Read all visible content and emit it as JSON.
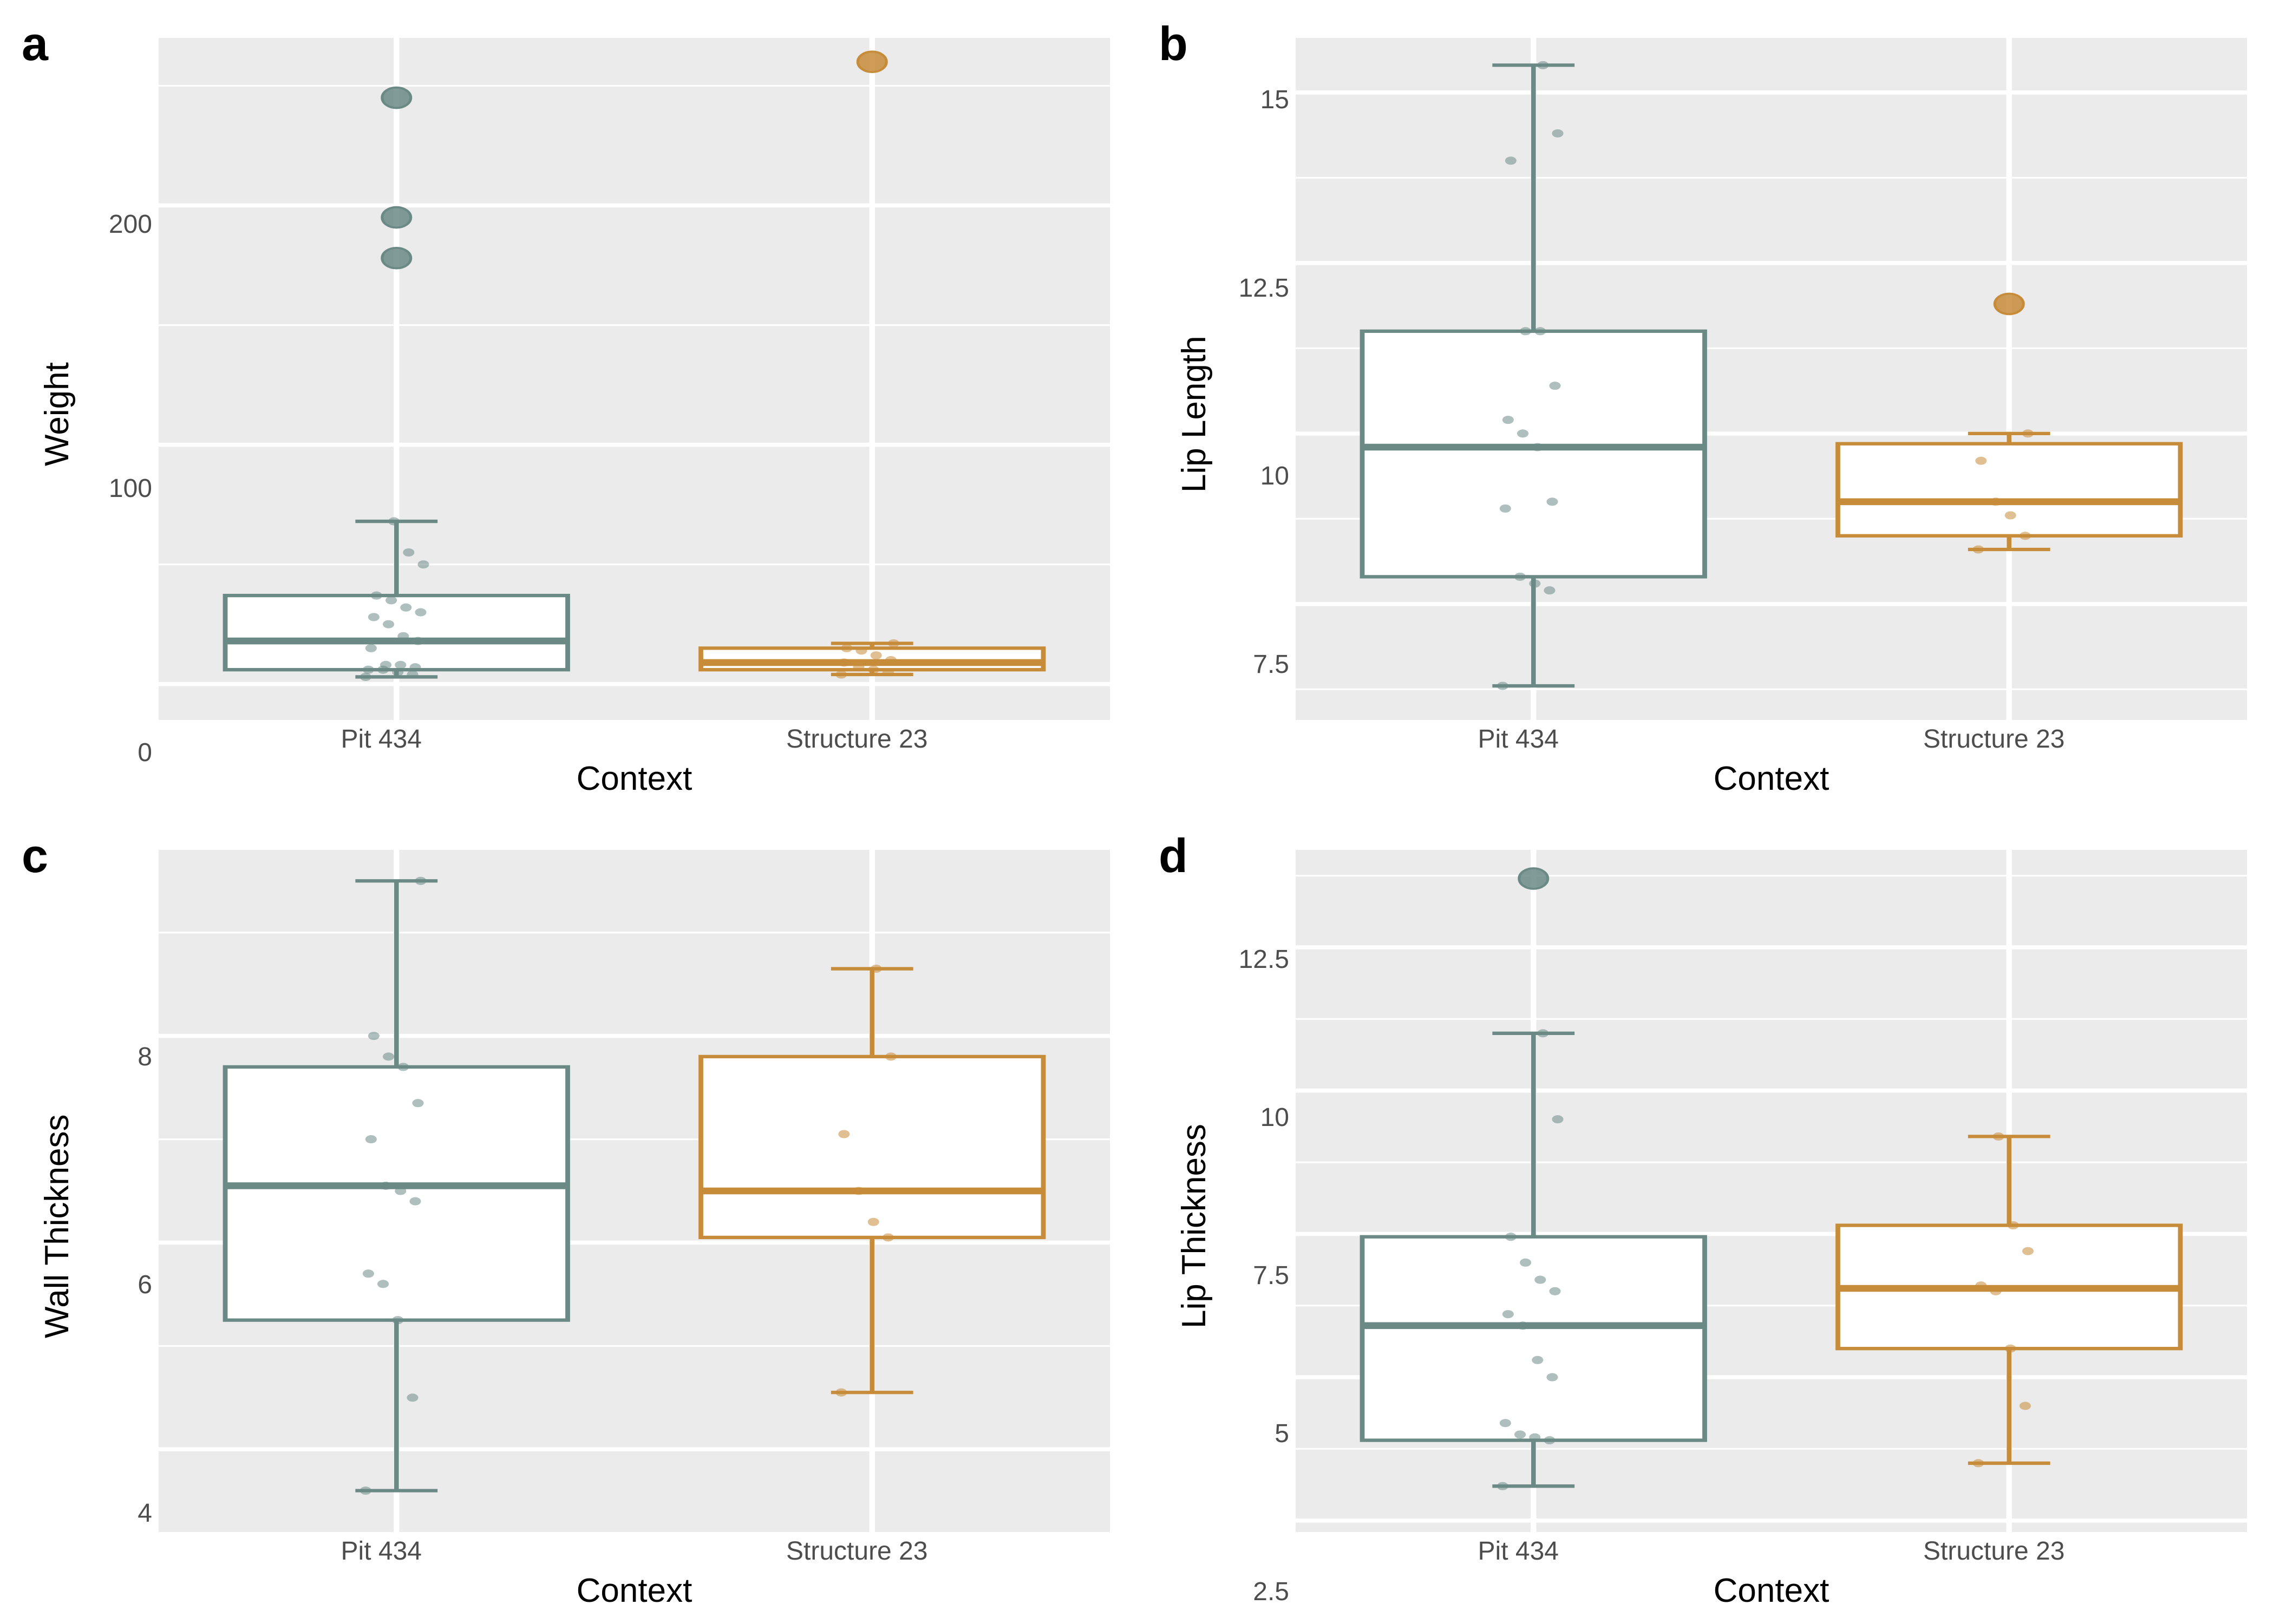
{
  "chart_data": [
    {
      "id": "a",
      "type": "box",
      "ylabel": "Weight",
      "xlabel": "Context",
      "categories": [
        "Pit 434",
        "Structure 23"
      ],
      "colors": [
        "#6b8a86",
        "#c78c3a"
      ],
      "ylim": [
        -15,
        270
      ],
      "yticks": [
        0,
        100,
        200
      ],
      "series": [
        {
          "context": "Pit 434",
          "q1": 6,
          "median": 18,
          "q3": 37,
          "whisker_lo": 3,
          "whisker_hi": 68,
          "outliers": [
            178,
            195,
            245
          ],
          "points": [
            3,
            4,
            5,
            6,
            6,
            7,
            8,
            8,
            15,
            18,
            20,
            25,
            28,
            30,
            32,
            35,
            37,
            50,
            55,
            68
          ]
        },
        {
          "context": "Structure 23",
          "q1": 6,
          "median": 9,
          "q3": 15,
          "whisker_lo": 4,
          "whisker_hi": 17,
          "outliers": [
            260
          ],
          "points": [
            4,
            5,
            6,
            7,
            9,
            10,
            12,
            14,
            15,
            17
          ]
        }
      ]
    },
    {
      "id": "b",
      "type": "box",
      "ylabel": "Lip Length",
      "xlabel": "Context",
      "categories": [
        "Pit 434",
        "Structure 23"
      ],
      "colors": [
        "#6b8a86",
        "#c78c3a"
      ],
      "ylim": [
        5.8,
        15.8
      ],
      "yticks": [
        7.5,
        10.0,
        12.5,
        15.0
      ],
      "series": [
        {
          "context": "Pit 434",
          "q1": 7.9,
          "median": 9.8,
          "q3": 11.5,
          "whisker_lo": 6.3,
          "whisker_hi": 15.4,
          "outliers": [],
          "points": [
            6.3,
            7.7,
            7.8,
            7.9,
            8.9,
            9.0,
            9.8,
            10.0,
            10.2,
            10.7,
            11.5,
            11.5,
            14.0,
            14.4,
            15.4
          ]
        },
        {
          "context": "Structure 23",
          "q1": 8.5,
          "median": 9.0,
          "q3": 9.85,
          "whisker_lo": 8.3,
          "whisker_hi": 10.0,
          "outliers": [
            11.9
          ],
          "points": [
            8.3,
            8.5,
            8.8,
            9.0,
            9.6,
            10.0
          ]
        }
      ]
    },
    {
      "id": "c",
      "type": "box",
      "ylabel": "Wall Thickness",
      "xlabel": "Context",
      "categories": [
        "Pit 434",
        "Structure 23"
      ],
      "colors": [
        "#6b8a86",
        "#c78c3a"
      ],
      "ylim": [
        3.2,
        9.8
      ],
      "yticks": [
        4,
        6,
        8
      ],
      "series": [
        {
          "context": "Pit 434",
          "q1": 5.25,
          "median": 6.55,
          "q3": 7.7,
          "whisker_lo": 3.6,
          "whisker_hi": 9.5,
          "outliers": [],
          "points": [
            3.6,
            4.5,
            5.25,
            5.6,
            5.7,
            6.4,
            6.5,
            6.55,
            7.0,
            7.35,
            7.7,
            7.8,
            8.0,
            9.5
          ]
        },
        {
          "context": "Structure 23",
          "q1": 6.05,
          "median": 6.5,
          "q3": 7.8,
          "whisker_lo": 4.55,
          "whisker_hi": 8.65,
          "outliers": [],
          "points": [
            4.55,
            6.05,
            6.2,
            6.5,
            7.05,
            7.8,
            8.65
          ]
        }
      ]
    },
    {
      "id": "d",
      "type": "box",
      "ylabel": "Lip Thickness",
      "xlabel": "Context",
      "categories": [
        "Pit 434",
        "Structure 23"
      ],
      "colors": [
        "#6b8a86",
        "#c78c3a"
      ],
      "ylim": [
        2.3,
        14.2
      ],
      "yticks": [
        2.5,
        5.0,
        7.5,
        10.0,
        12.5
      ],
      "series": [
        {
          "context": "Pit 434",
          "q1": 3.9,
          "median": 5.9,
          "q3": 7.45,
          "whisker_lo": 3.1,
          "whisker_hi": 11.0,
          "outliers": [
            13.7
          ],
          "points": [
            3.1,
            3.9,
            3.95,
            4.0,
            4.2,
            5.0,
            5.3,
            5.9,
            6.1,
            6.5,
            6.7,
            7.0,
            7.45,
            9.5,
            11.0
          ]
        },
        {
          "context": "Structure 23",
          "q1": 5.5,
          "median": 6.55,
          "q3": 7.65,
          "whisker_lo": 3.5,
          "whisker_hi": 9.2,
          "outliers": [],
          "points": [
            3.5,
            4.5,
            5.5,
            6.5,
            6.6,
            7.2,
            7.65,
            9.2
          ]
        }
      ]
    }
  ]
}
